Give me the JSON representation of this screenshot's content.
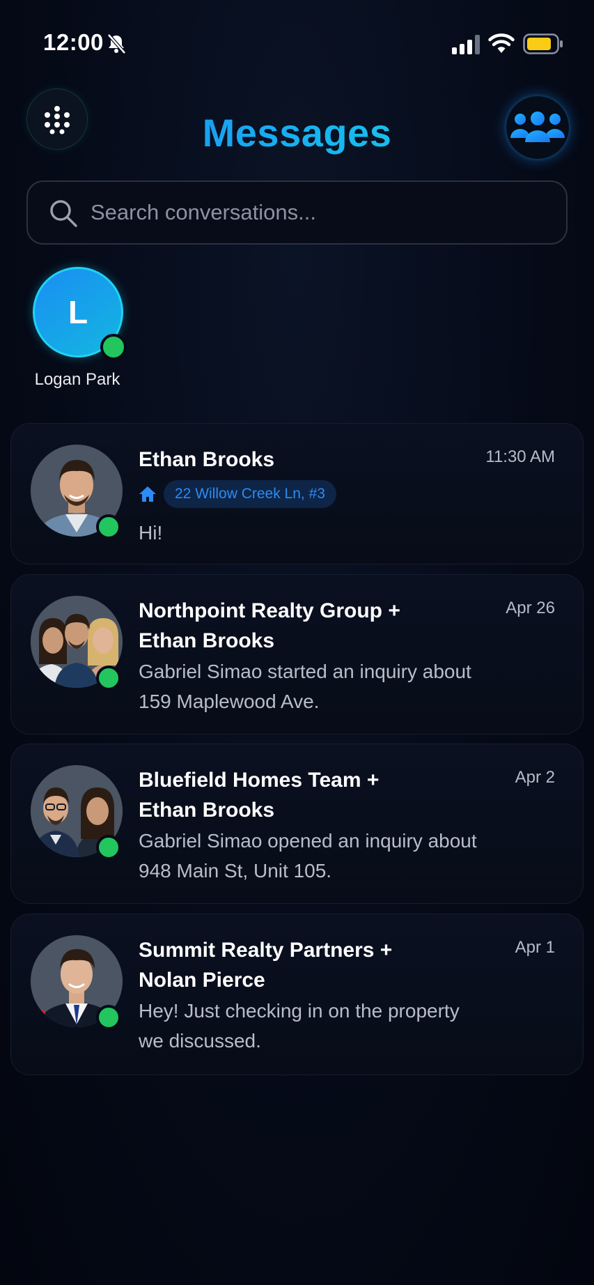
{
  "status_bar": {
    "time": "12:00",
    "bell_icon": "bell-slash-icon",
    "signal_icon": "cellular-signal-icon",
    "wifi_icon": "wifi-icon",
    "battery_icon": "battery-icon",
    "battery_color": "#facc15"
  },
  "header": {
    "title": "Messages",
    "apps_icon": "dots-grid-icon",
    "group_icon": "users-group-icon",
    "accent_color": "#1f9bf5"
  },
  "search": {
    "placeholder": "Search conversations...",
    "value": ""
  },
  "online_contacts": [
    {
      "initial": "L",
      "name": "Logan Park",
      "status": "online"
    }
  ],
  "conversations": [
    {
      "title_line1": "Ethan Brooks",
      "title_line2": "",
      "time": "11:30 AM",
      "property_icon": "home-icon",
      "property": "22 Willow Creek Ln, #3",
      "preview_line1": "Hi!",
      "preview_line2": "",
      "status": "online"
    },
    {
      "title_line1": "Northpoint Realty Group +",
      "title_line2": "Ethan Brooks",
      "time": "Apr 26",
      "preview_line1": "Gabriel Simao started an inquiry about",
      "preview_line2": "159 Maplewood Ave.",
      "status": "online"
    },
    {
      "title_line1": "Bluefield Homes Team +",
      "title_line2": "Ethan Brooks",
      "time": "Apr 2",
      "preview_line1": "Gabriel Simao opened an inquiry about",
      "preview_line2": "948 Main St, Unit 105.",
      "status": "online"
    },
    {
      "title_line1": "Summit Realty Partners +",
      "title_line2": "Nolan Pierce",
      "time": "Apr 1",
      "preview_line1": "Hey! Just checking in on the property",
      "preview_line2": "we discussed.",
      "status": "online"
    }
  ],
  "colors": {
    "background": "#050a17",
    "online_green": "#22c55e",
    "property_tag_text": "#2b8cf5",
    "property_tag_bg": "#0e2547"
  }
}
